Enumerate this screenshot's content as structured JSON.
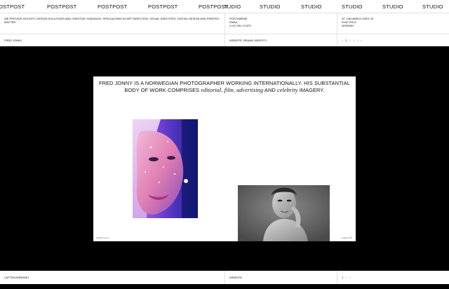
{
  "marquee": {
    "items": [
      "OSTPOST",
      "POSTPOST",
      "POSTPOST",
      "POSTPOST",
      "POSTPOST",
      "TUDIO",
      "STUDIO",
      "STUDIO",
      "STUDIO",
      "STUDIO",
      "STUDIO"
    ]
  },
  "info": {
    "description": "WE PROVIDE HOLISTIC DESIGN SOLUTIONS AND CREATIVE GUIDANCE, SPECIALISING IN ART DIRECTION, VISUAL IDENTITIES, DIGITAL DESIGN AND PRINTED MATTER.",
    "contact": [
      "POSTWARNE",
      "EMAIL",
      "(+47) 951 13 875"
    ],
    "address": [
      "ST. HALVARDS GATE 33",
      "0192 OSLO",
      "NORWAY"
    ]
  },
  "project": {
    "client": "FRED JONNY",
    "type": "WEBSITE, BRAND IDENTITY",
    "pager": [
      "1",
      "2",
      "3",
      "4",
      "5",
      "6"
    ],
    "active_index": 1
  },
  "slide": {
    "headline_a": "FRED JONNY IS A NORWEGIAN PHOTOGRAPHER WORKING INTERNATIONALLY. HIS SUBSTANTIAL BODY OF WORK COMPRISES ",
    "headline_em1": "editorial",
    "headline_sep1": ", ",
    "headline_em2": "film",
    "headline_sep2": ", ",
    "headline_em3": "advertising",
    "headline_mid": " AND ",
    "headline_em4": "celebrity",
    "headline_end": " IMAGERY.",
    "caption_left": "fredjonny.com",
    "caption_right": "Loading 1/5"
  },
  "bottom": {
    "client": "LAFTEKOMPANIET",
    "type": "WEBSITE",
    "pager": [
      "1",
      "2",
      "3"
    ],
    "active_index": 0
  }
}
